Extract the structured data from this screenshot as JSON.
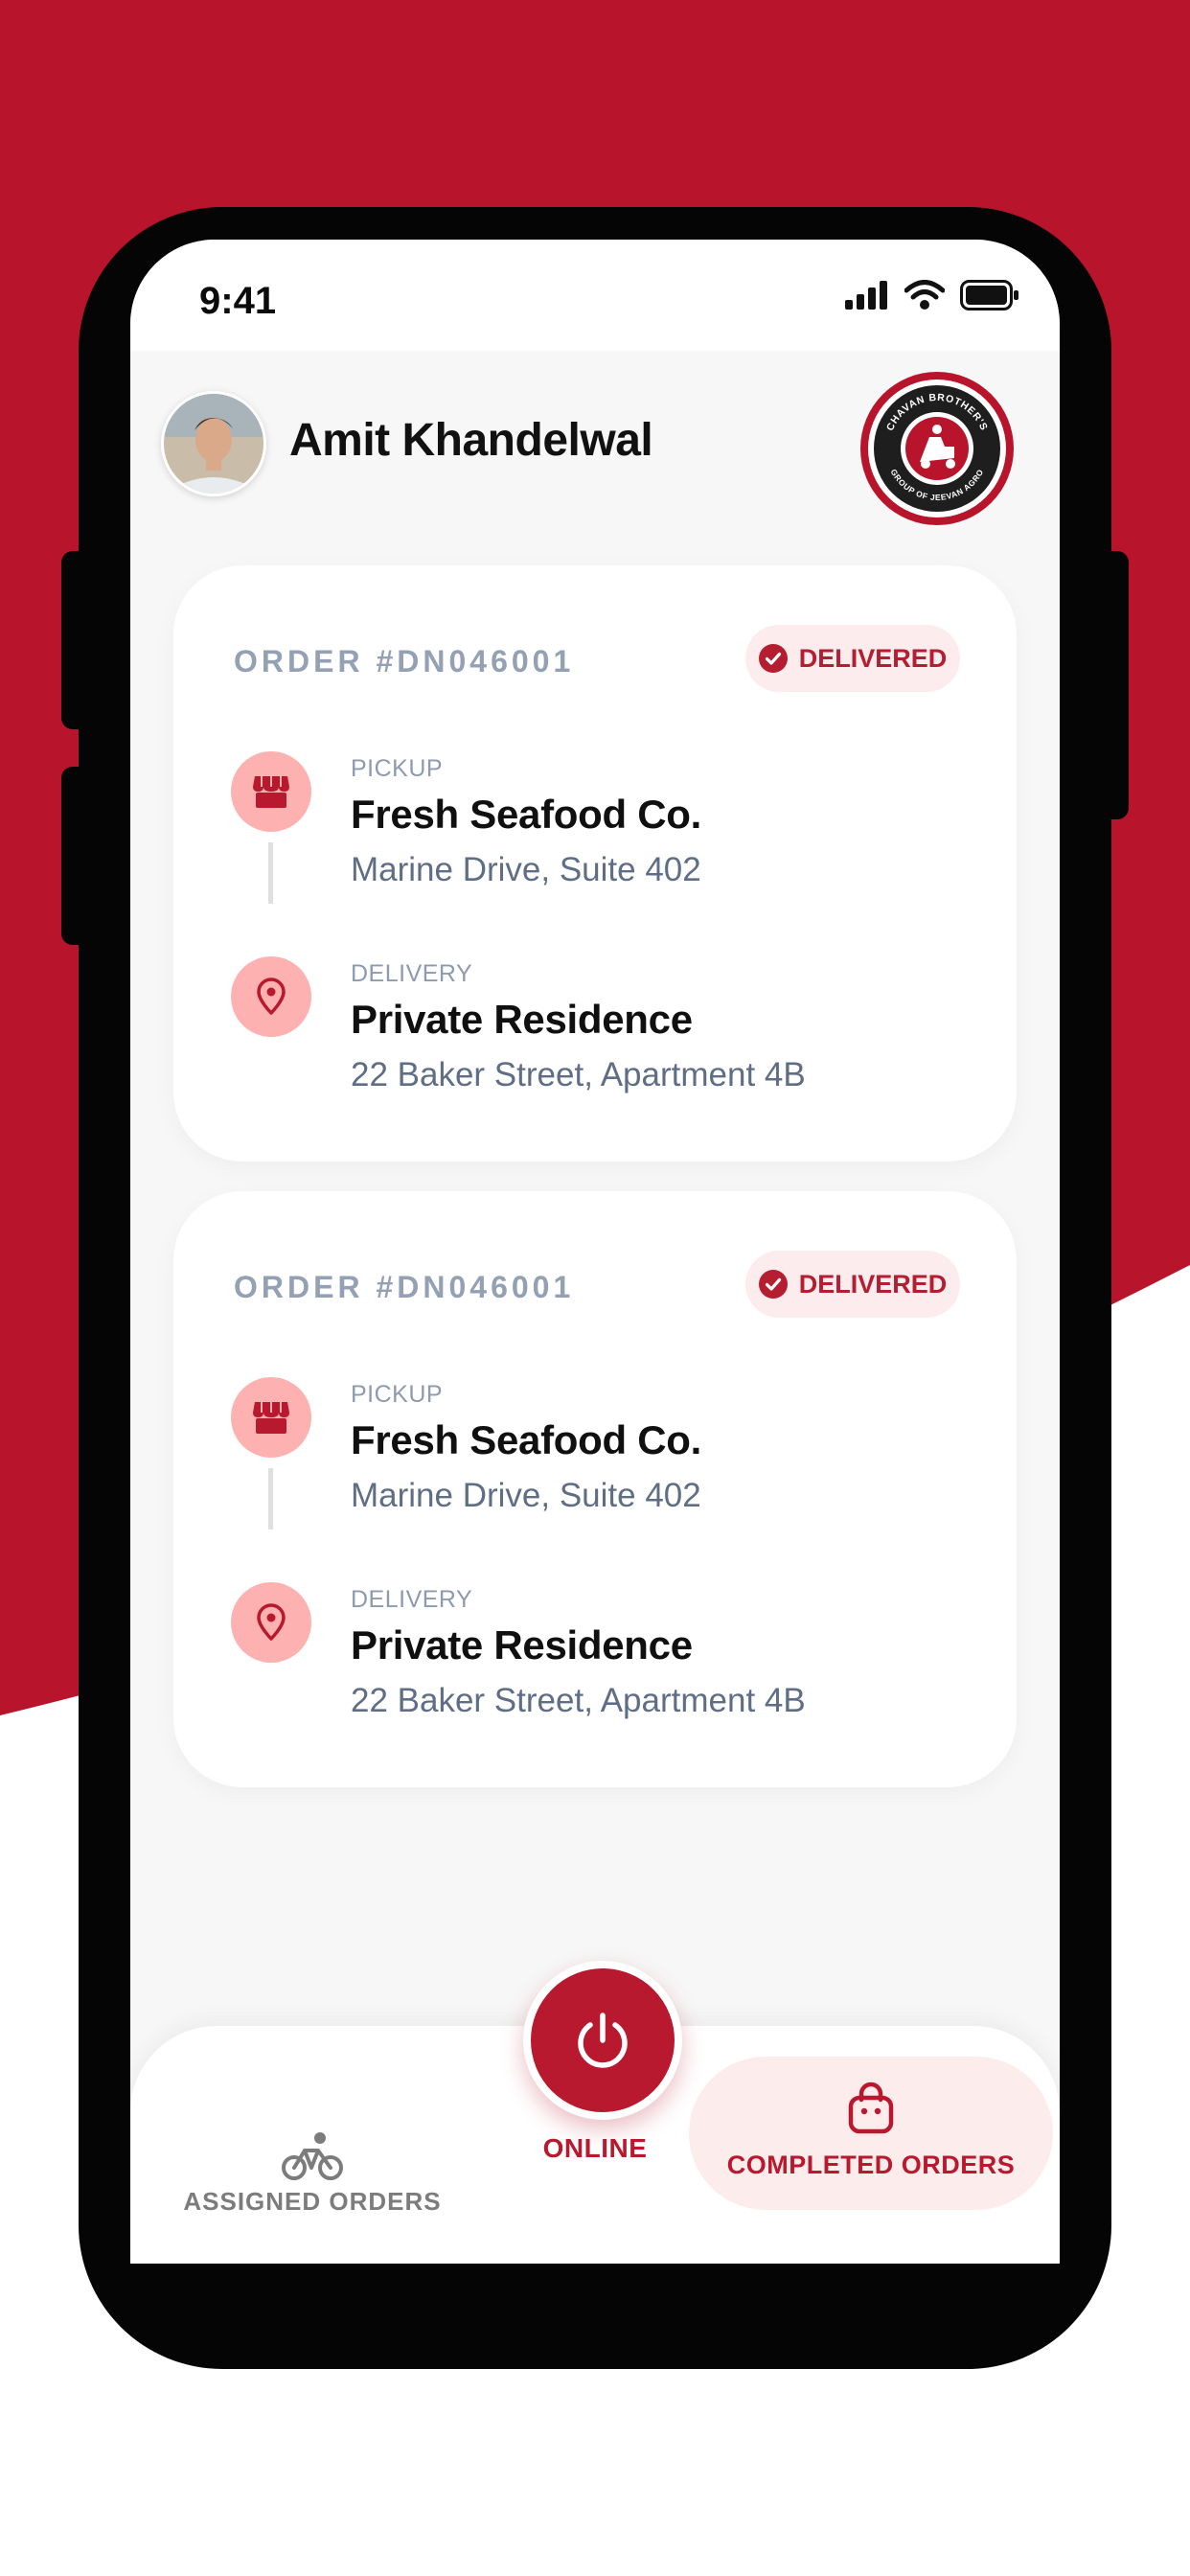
{
  "colors": {
    "brand_red": "#b8192e",
    "screen_bg": "#f7f7f7",
    "badge_bg": "#fdecee",
    "pin_bg": "#fdb2b1"
  },
  "status_bar": {
    "time": "9:41",
    "icons": [
      "cellular-signal-icon",
      "wifi-icon",
      "battery-icon"
    ]
  },
  "header": {
    "user_name": "Amit Khandelwal",
    "avatar": "avatar",
    "logo": {
      "top_text": "CHAVAN BROTHER'S",
      "bottom_text": "GROUP OF JEEVAN AGRO"
    }
  },
  "orders": [
    {
      "order_id": "ORDER #DN046001",
      "status": "DELIVERED",
      "pickup": {
        "kind": "PICKUP",
        "name": "Fresh Seafood Co.",
        "address": "Marine Drive, Suite 402",
        "icon": "store-icon"
      },
      "delivery": {
        "kind": "DELIVERY",
        "name": "Private Residence",
        "address": "22 Baker Street, Apartment 4B",
        "icon": "location-pin-icon"
      }
    },
    {
      "order_id": "ORDER #DN046001",
      "status": "DELIVERED",
      "pickup": {
        "kind": "PICKUP",
        "name": "Fresh Seafood Co.",
        "address": "Marine Drive, Suite 402",
        "icon": "store-icon"
      },
      "delivery": {
        "kind": "DELIVERY",
        "name": "Private Residence",
        "address": "22 Baker Street, Apartment 4B",
        "icon": "location-pin-icon"
      }
    }
  ],
  "bottom_nav": {
    "assigned": {
      "label": "ASSIGNED ORDERS",
      "icon": "bicycle-icon"
    },
    "online": {
      "label": "ONLINE",
      "icon": "power-icon"
    },
    "completed": {
      "label": "COMPLETED ORDERS",
      "icon": "shopping-bag-icon"
    }
  }
}
